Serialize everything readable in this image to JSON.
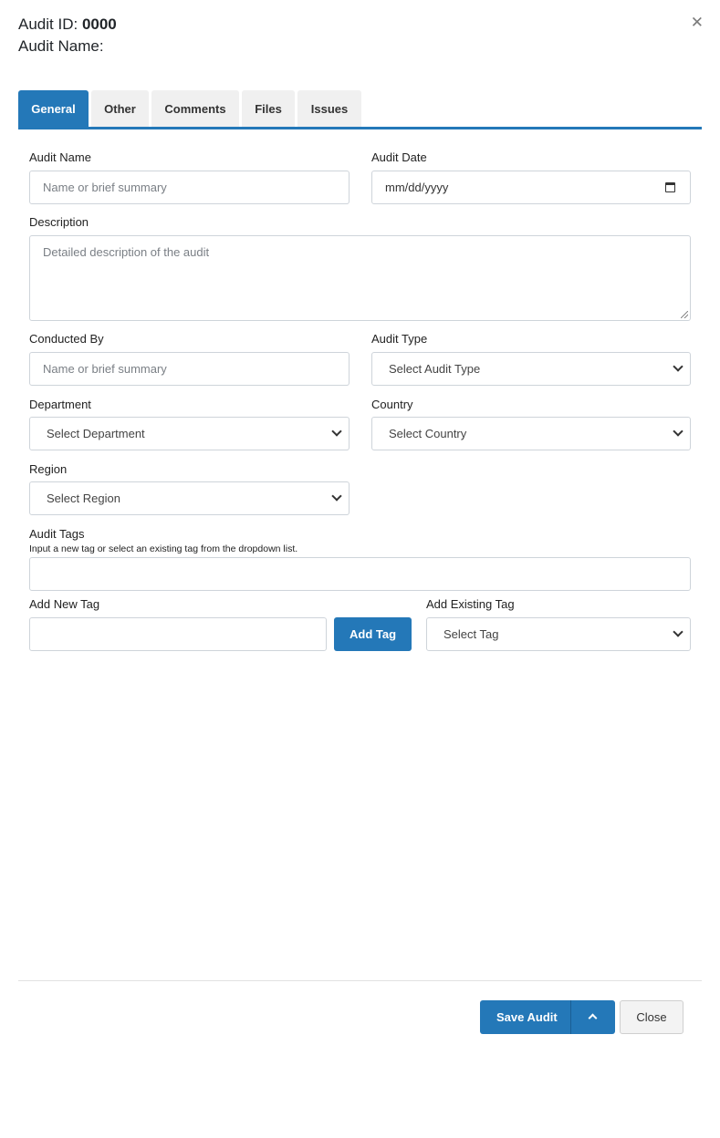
{
  "header": {
    "audit_id_label": "Audit ID:",
    "audit_id_value": "0000",
    "audit_name_label": "Audit Name:",
    "close_icon": "close-icon"
  },
  "tabs": [
    {
      "label": "General",
      "active": true
    },
    {
      "label": "Other",
      "active": false
    },
    {
      "label": "Comments",
      "active": false
    },
    {
      "label": "Files",
      "active": false
    },
    {
      "label": "Issues",
      "active": false
    }
  ],
  "form": {
    "audit_name": {
      "label": "Audit Name",
      "value": "",
      "placeholder": "Name or brief summary"
    },
    "audit_date": {
      "label": "Audit Date",
      "value": "",
      "placeholder": "mm/dd/yyyy"
    },
    "description": {
      "label": "Description",
      "value": "",
      "placeholder": "Detailed description of the audit"
    },
    "conducted_by": {
      "label": "Conducted By",
      "value": "",
      "placeholder": "Name or brief summary"
    },
    "audit_type": {
      "label": "Audit Type",
      "selected": "Select Audit Type"
    },
    "department": {
      "label": "Department",
      "selected": "Select Department"
    },
    "country": {
      "label": "Country",
      "selected": "Select Country"
    },
    "region": {
      "label": "Region",
      "selected": "Select Region"
    },
    "audit_tags": {
      "label": "Audit Tags",
      "hint": "Input a new tag or select an existing tag from the dropdown list.",
      "value": ""
    },
    "add_new_tag": {
      "label": "Add New Tag",
      "value": "",
      "button": "Add Tag"
    },
    "add_existing_tag": {
      "label": "Add Existing Tag",
      "selected": "Select Tag"
    }
  },
  "footer": {
    "save_label": "Save Audit",
    "close_label": "Close"
  },
  "colors": {
    "accent": "#2478b8",
    "tab_inactive": "#f0f0f0"
  }
}
